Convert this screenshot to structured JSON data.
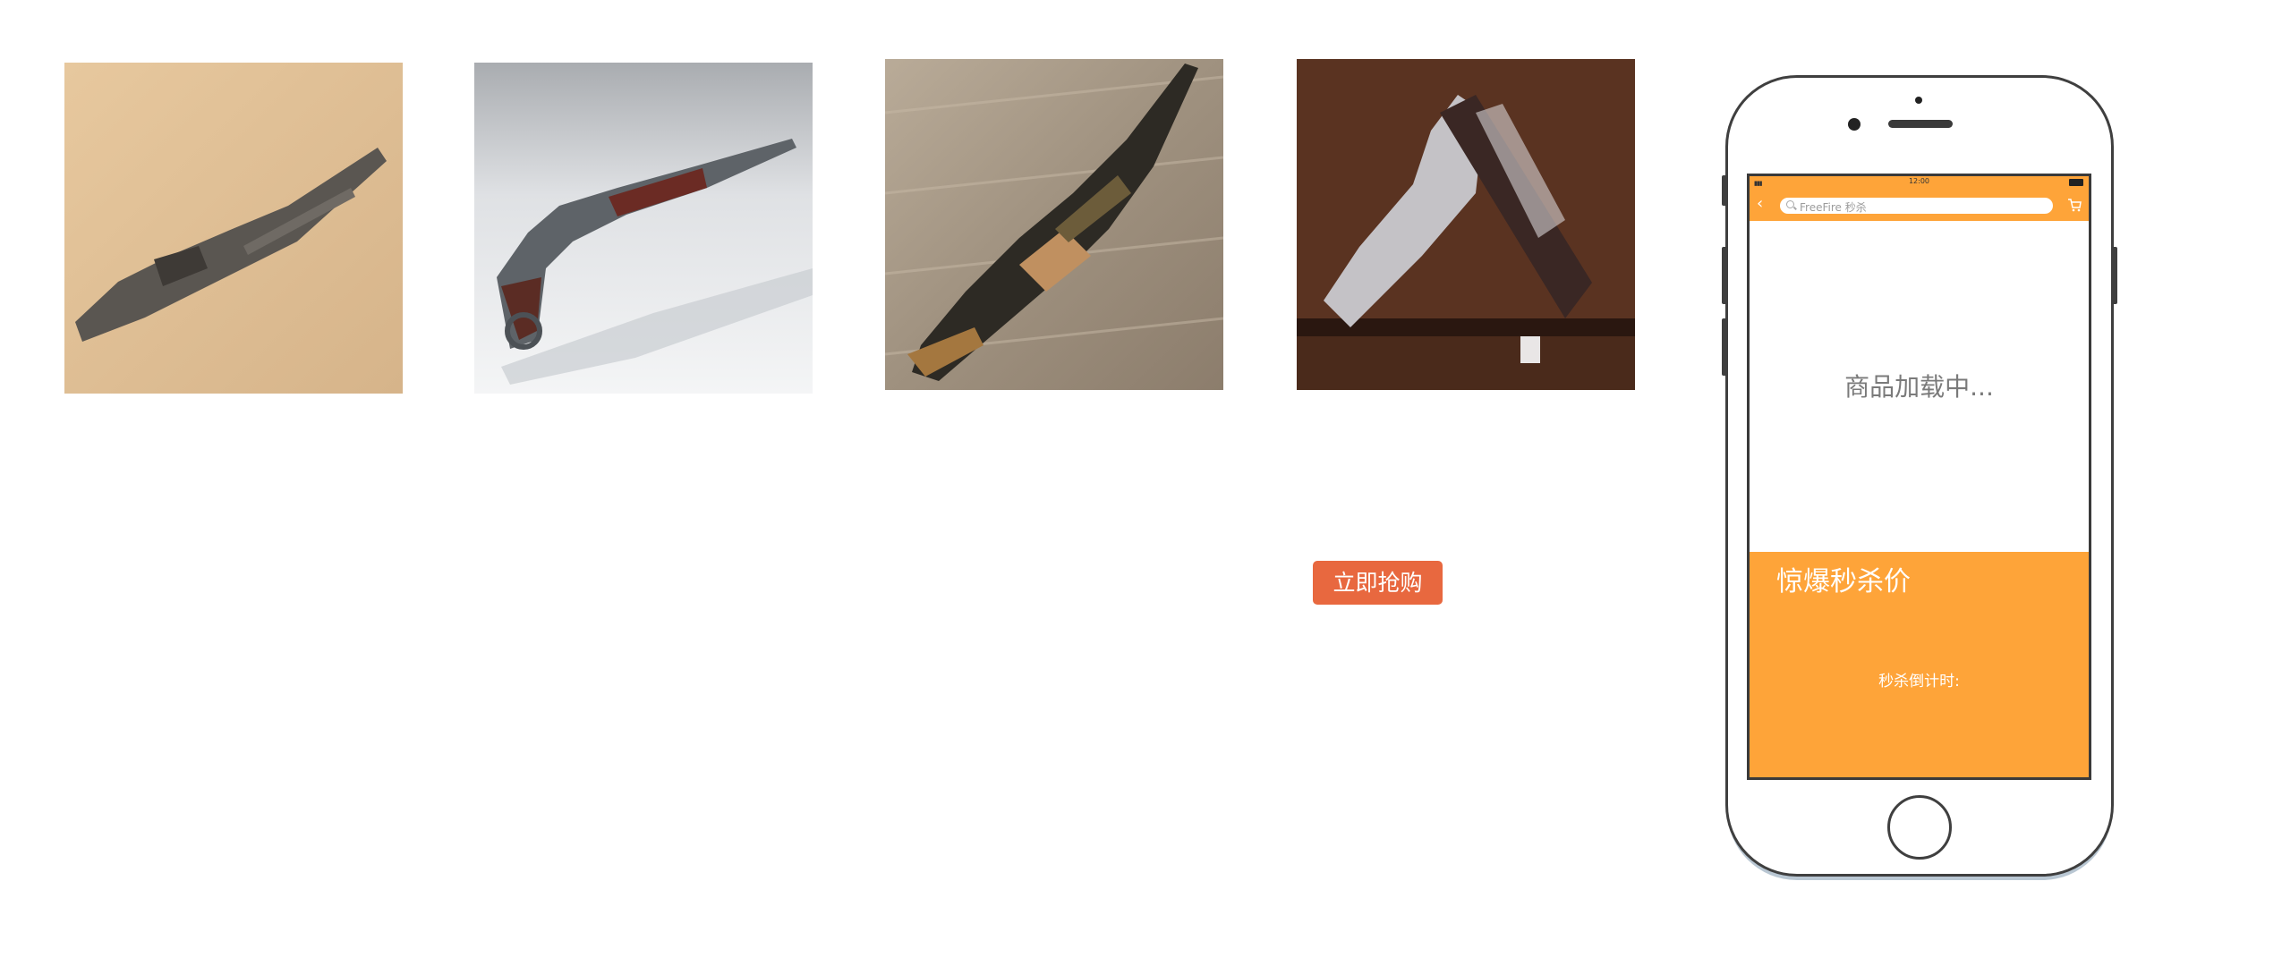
{
  "products": [
    {
      "icon": "rifle-photo"
    },
    {
      "icon": "shotgun-photo"
    },
    {
      "icon": "assault-rifle-photo"
    },
    {
      "icon": "pistol-photo"
    }
  ],
  "buy_button": {
    "label": "立即抢购"
  },
  "phone": {
    "status_bar": {
      "time": "12:00"
    },
    "nav": {
      "search_text": "FreeFire 秒杀"
    },
    "loading_text": "商品加载中...",
    "promo": {
      "title": "惊爆秒杀价",
      "countdown_label": "秒杀倒计时:"
    },
    "colors": {
      "accent": "#fea439",
      "button": "#e8683f"
    }
  }
}
